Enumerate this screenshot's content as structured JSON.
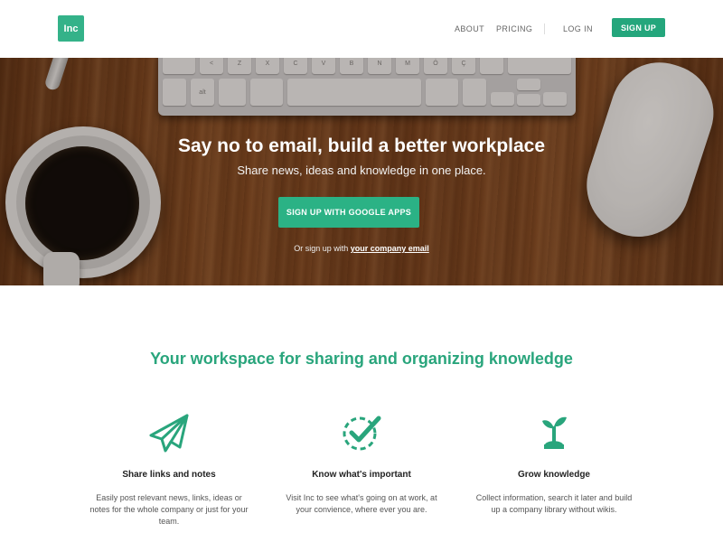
{
  "header": {
    "logo": "Inc",
    "nav": {
      "about": "ABOUT",
      "pricing": "PRICING",
      "login": "LOG IN",
      "signup": "SIGN UP"
    }
  },
  "hero": {
    "title": "Say no to email, build a better workplace",
    "subtitle": "Share news, ideas and knowledge in one place.",
    "cta": "SIGN UP WITH GOOGLE APPS",
    "alt_prefix": "Or sign up with",
    "alt_link": "your company email",
    "keyboard_keys": [
      "<",
      "Z",
      "X",
      "C",
      "V",
      "B",
      "N",
      "M",
      "Ö",
      "Ç",
      "alt"
    ]
  },
  "features": {
    "title": "Your workspace for sharing and organizing knowledge",
    "items": [
      {
        "icon": "paper-plane-icon",
        "title": "Share links and notes",
        "text": "Easily post relevant news, links, ideas or notes for the whole company or just for your team."
      },
      {
        "icon": "check-badge-icon",
        "title": "Know what's important",
        "text": "Visit Inc to see what's going on at work, at your convience, where ever you are."
      },
      {
        "icon": "sprout-icon",
        "title": "Grow knowledge",
        "text": "Collect information, search it later and build up a company library without wikis."
      }
    ]
  },
  "colors": {
    "accent": "#29a57c",
    "button": "#24a67c",
    "wood": "#8a4f26"
  }
}
